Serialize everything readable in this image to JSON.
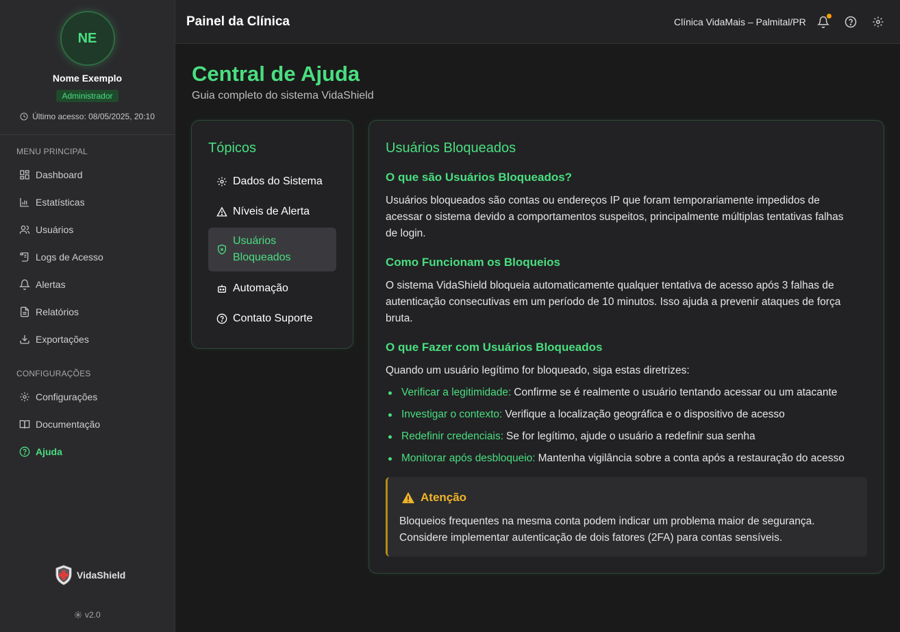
{
  "profile": {
    "initials": "NE",
    "name": "Nome Exemplo",
    "role": "Administrador",
    "last_access": "Último acesso: 08/05/2025, 20:10"
  },
  "sidebar": {
    "main_title": "MENU PRINCIPAL",
    "main_items": [
      {
        "label": "Dashboard",
        "icon": "dashboard-icon"
      },
      {
        "label": "Estatísticas",
        "icon": "bar-chart-icon"
      },
      {
        "label": "Usuários",
        "icon": "users-icon"
      },
      {
        "label": "Logs de Acesso",
        "icon": "scroll-icon"
      },
      {
        "label": "Alertas",
        "icon": "bell-icon"
      },
      {
        "label": "Relatórios",
        "icon": "file-icon"
      },
      {
        "label": "Exportações",
        "icon": "download-icon"
      }
    ],
    "config_title": "CONFIGURAÇÕES",
    "config_items": [
      {
        "label": "Configurações",
        "icon": "gear-icon"
      },
      {
        "label": "Documentação",
        "icon": "book-icon"
      },
      {
        "label": "Ajuda",
        "icon": "help-circle-icon",
        "active": true
      }
    ],
    "brand": "VidaShield",
    "version": "v2.0"
  },
  "topbar": {
    "title": "Painel da Clínica",
    "clinic": "Clínica VidaMais – Palmital/PR"
  },
  "page": {
    "title": "Central de Ajuda",
    "subtitle": "Guia completo do sistema VidaShield"
  },
  "topics": {
    "title": "Tópicos",
    "items": [
      {
        "label": "Dados do Sistema",
        "icon": "gear-icon"
      },
      {
        "label": "Níveis de Alerta",
        "icon": "warning-icon"
      },
      {
        "label": "Usuários Bloqueados",
        "icon": "shield-x-icon",
        "active": true
      },
      {
        "label": "Automação",
        "icon": "robot-icon"
      },
      {
        "label": "Contato Suporte",
        "icon": "help-circle-icon"
      }
    ]
  },
  "content": {
    "title": "Usuários Bloqueados",
    "s1_title": "O que são Usuários Bloqueados?",
    "s1_text": "Usuários bloqueados são contas ou endereços IP que foram temporariamente impedidos de acessar o sistema devido a comportamentos suspeitos, principalmente múltiplas tentativas falhas de login.",
    "s2_title": "Como Funcionam os Bloqueios",
    "s2_text": "O sistema VidaShield bloqueia automaticamente qualquer tentativa de acesso após 3 falhas de autenticação consecutivas em um período de 10 minutos. Isso ajuda a prevenir ataques de força bruta.",
    "s3_title": "O que Fazer com Usuários Bloqueados",
    "s3_intro": "Quando um usuário legítimo for bloqueado, siga estas diretrizes:",
    "bullets": [
      {
        "key": "Verificar a legitimidade:",
        "text": "Confirme se é realmente o usuário tentando acessar ou um atacante"
      },
      {
        "key": "Investigar o contexto:",
        "text": "Verifique a localização geográfica e o dispositivo de acesso"
      },
      {
        "key": "Redefinir credenciais:",
        "text": "Se for legítimo, ajude o usuário a redefinir sua senha"
      },
      {
        "key": "Monitorar após desbloqueio:",
        "text": "Mantenha vigilância sobre a conta após a restauração do acesso"
      }
    ],
    "warning_title": "Atenção",
    "warning_text": "Bloqueios frequentes na mesma conta podem indicar um problema maior de segurança. Considere implementar autenticação de dois fatores (2FA) para contas sensíveis."
  },
  "colors": {
    "accent": "#4ade80",
    "warning": "#f0b429",
    "notification": "#f59e0b"
  }
}
